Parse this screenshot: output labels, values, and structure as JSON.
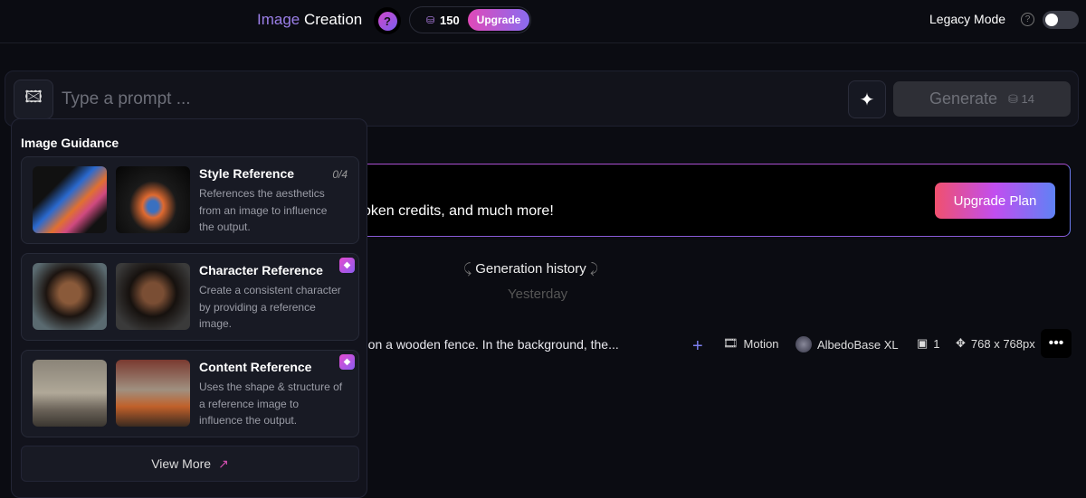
{
  "header": {
    "title_accent": "Image",
    "title_main": "Creation",
    "help": "?",
    "credits": "150",
    "upgrade": "Upgrade",
    "legacy_label": "Legacy Mode",
    "legacy_help": "?"
  },
  "prompt": {
    "placeholder": "Type a prompt ...",
    "generate": "Generate",
    "generate_cost": "14"
  },
  "banner": {
    "text": "oken credits, and much more!",
    "button": "Upgrade Plan"
  },
  "history": {
    "title": "Generation history",
    "day": "Yesterday",
    "item": {
      "prompt": "g on a wooden fence. In the background, the...",
      "motion": "Motion",
      "model": "AlbedoBase XL",
      "count": "1",
      "size": "768 x 768px"
    }
  },
  "guidance": {
    "title": "Image Guidance",
    "cards": [
      {
        "title": "Style Reference",
        "count": "0/4",
        "desc": "References the aesthetics from an image to influence the output."
      },
      {
        "title": "Character Reference",
        "desc": "Create a consistent character by providing a reference image."
      },
      {
        "title": "Content Reference",
        "desc": "Uses the shape & structure of a reference image to influence the output."
      }
    ],
    "view_more": "View More"
  }
}
